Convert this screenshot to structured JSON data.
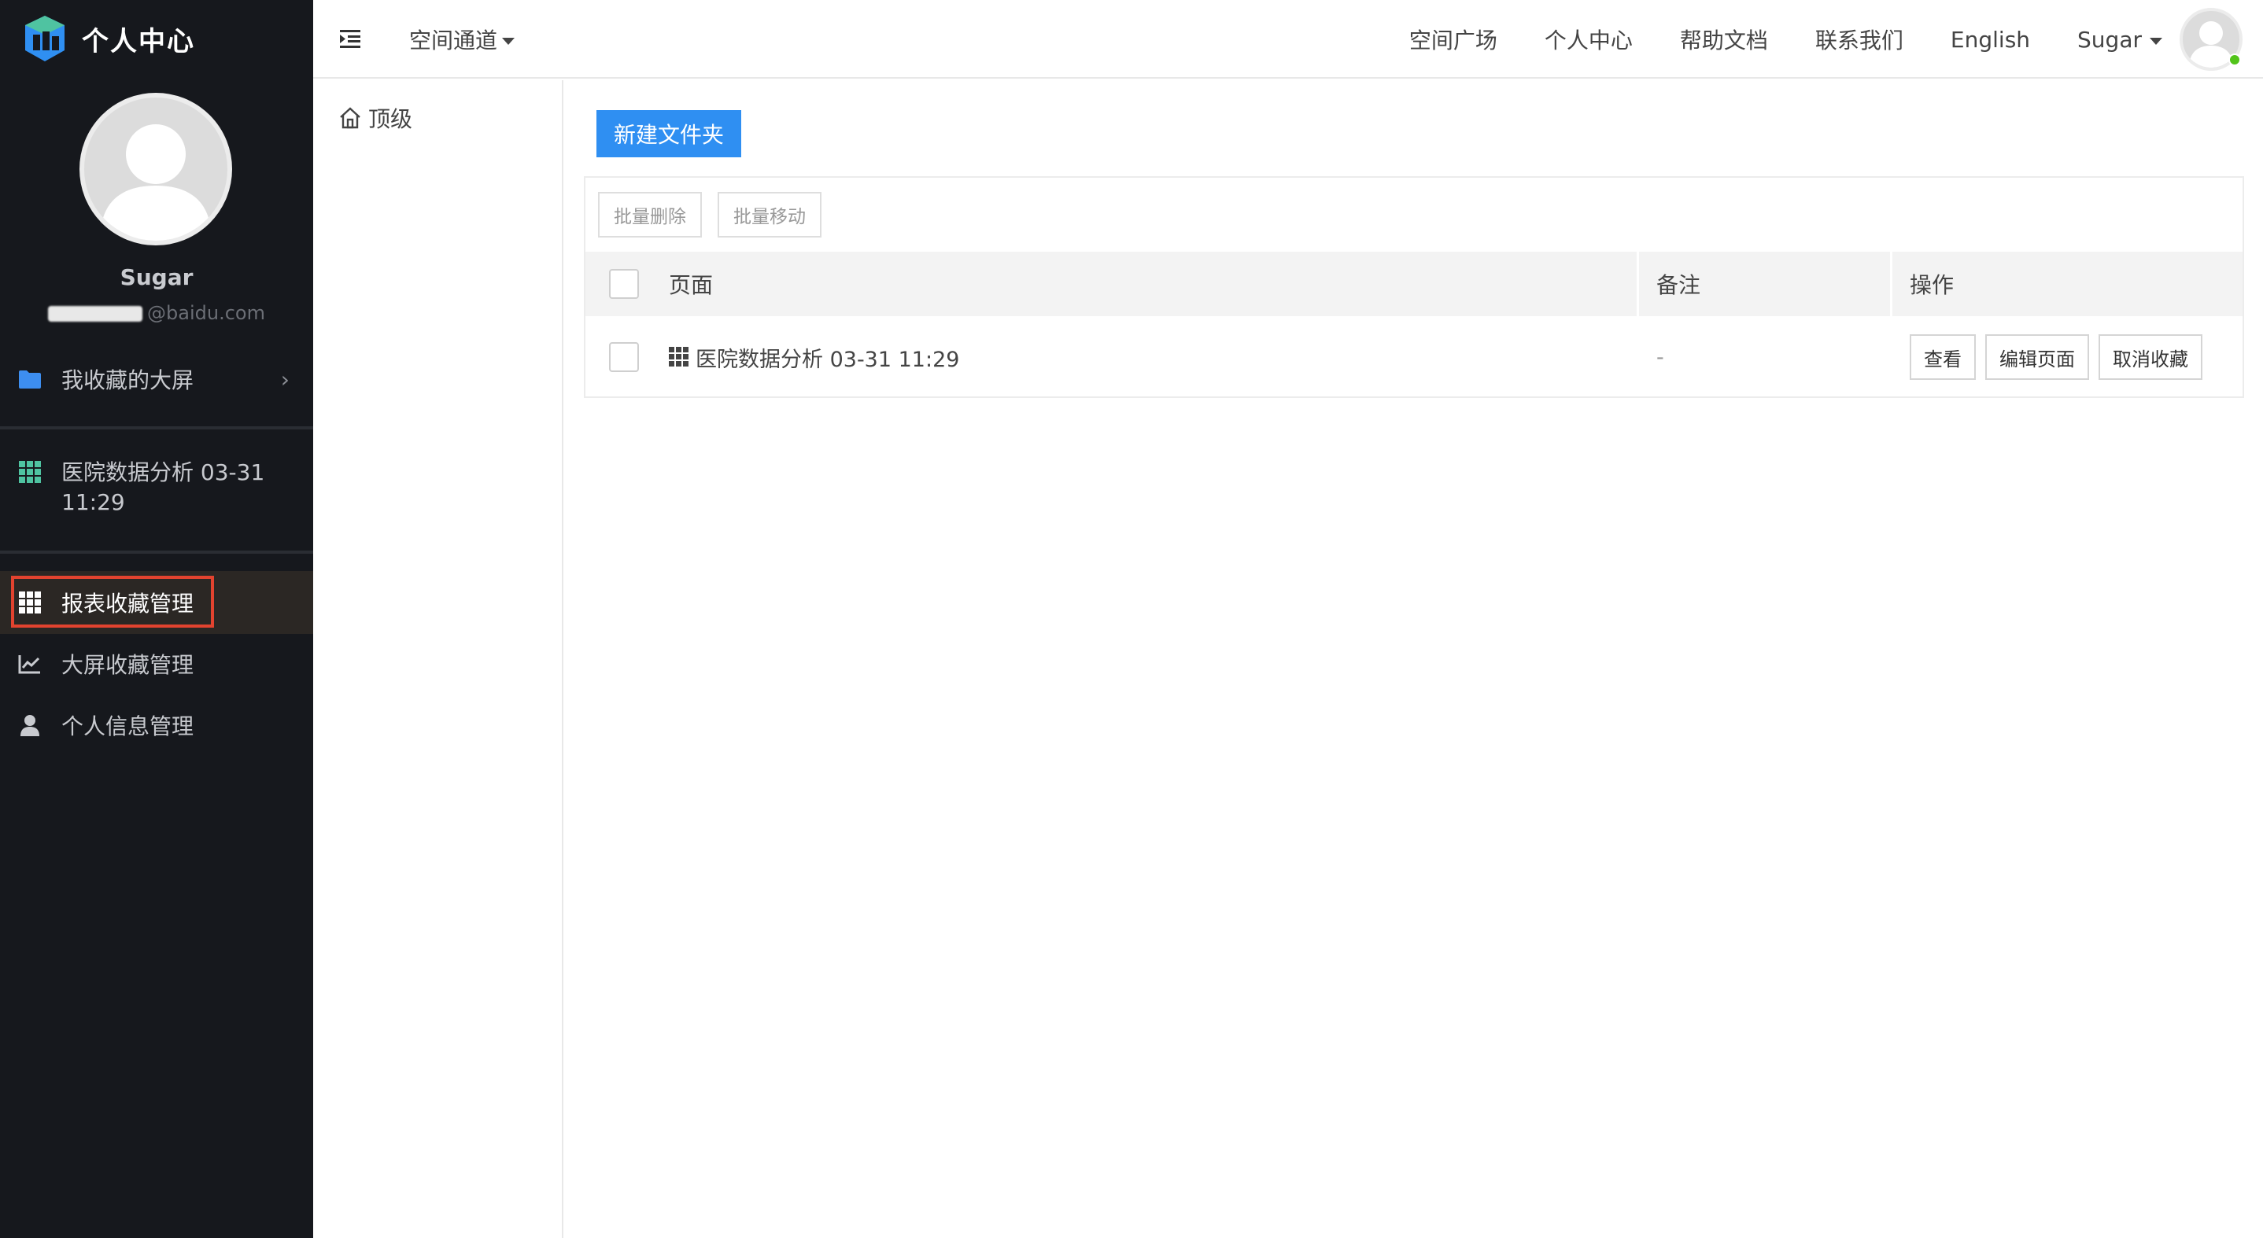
{
  "app": {
    "title": "个人中心"
  },
  "user": {
    "name": "Sugar",
    "email": "@baidu.com"
  },
  "sidebar": {
    "favorites_label": "我收藏的大屏",
    "favorite_items": [
      {
        "label": "医院数据分析 03-31 11:29"
      }
    ],
    "menu": [
      {
        "label": "报表收藏管理",
        "icon": "grid-icon",
        "active": true
      },
      {
        "label": "大屏收藏管理",
        "icon": "line-chart-icon"
      },
      {
        "label": "个人信息管理",
        "icon": "user-icon"
      }
    ]
  },
  "header": {
    "space_dropdown": "空间通道",
    "links": [
      "空间广场",
      "个人中心",
      "帮助文档",
      "联系我们",
      "English"
    ],
    "user_menu": "Sugar"
  },
  "folders": {
    "root": "顶级"
  },
  "main": {
    "new_folder": "新建文件夹",
    "bulk_delete": "批量删除",
    "bulk_move": "批量移动",
    "columns": [
      "页面",
      "备注",
      "操作"
    ],
    "rows": [
      {
        "page": "医院数据分析 03-31 11:29",
        "note": "-",
        "actions": [
          "查看",
          "编辑页面",
          "取消收藏"
        ]
      }
    ]
  },
  "colors": {
    "sidebar_bg": "#16181d",
    "primary": "#2f8ff2",
    "active_outline": "#e2432f",
    "online": "#52c41a"
  }
}
